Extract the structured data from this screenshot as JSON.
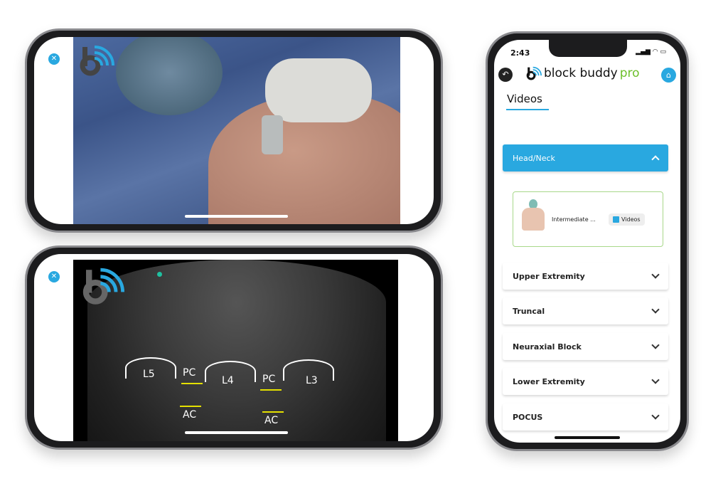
{
  "colors": {
    "accent": "#29a8e0",
    "pro_green": "#6cbf2a",
    "card_border": "#a8d88a"
  },
  "top_video": {
    "close_icon": "close-icon",
    "logo": "block buddy b-wifi logo"
  },
  "ultrasound": {
    "labels": {
      "l5": "L5",
      "pc1": "PC",
      "l4": "L4",
      "pc2": "PC",
      "l3": "L3",
      "ac1": "AC",
      "ac2": "AC"
    }
  },
  "app": {
    "status": {
      "time": "2:43"
    },
    "header": {
      "brand": "block buddy",
      "brand_suffix": "pro"
    },
    "tab": "Videos",
    "sections": [
      {
        "label": "Head/Neck",
        "expanded": true
      },
      {
        "label": "Upper Extremity"
      },
      {
        "label": "Truncal"
      },
      {
        "label": "Neuraxial Block"
      },
      {
        "label": "Lower Extremity"
      },
      {
        "label": "POCUS"
      }
    ],
    "card": {
      "title": "Intermediate ...",
      "button": "Videos"
    }
  }
}
